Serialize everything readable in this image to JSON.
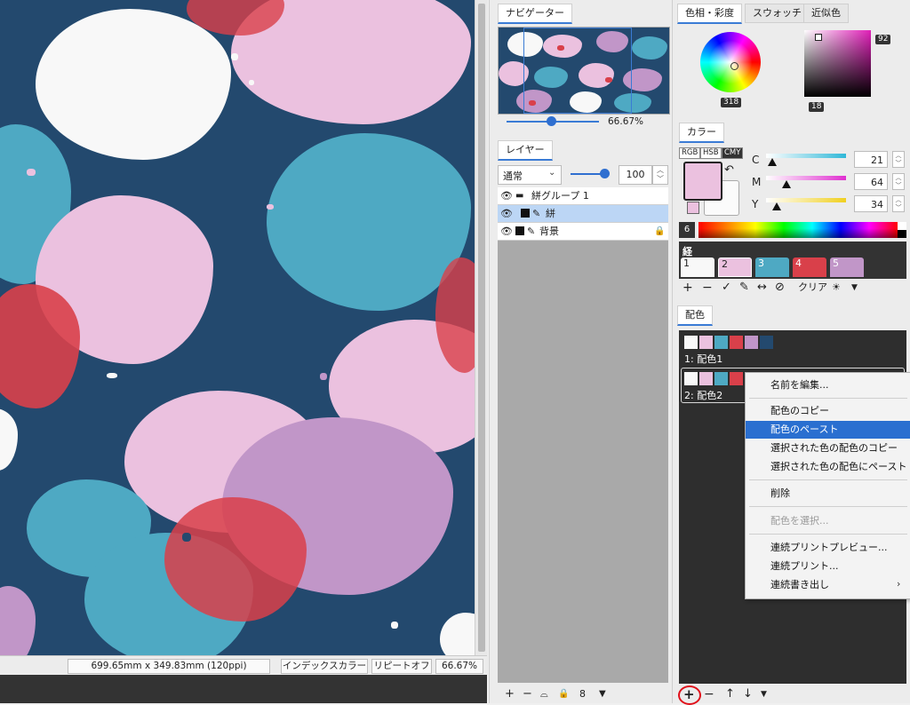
{
  "canvas": {
    "status": {
      "size": "699.65mm x 349.83mm (120ppi)",
      "mode": "インデックスカラー",
      "repeat": "リピートオフ",
      "zoom": "66.67%"
    }
  },
  "navigator": {
    "tab": "ナビゲーター",
    "zoom": "66.67%"
  },
  "layers": {
    "tab": "レイヤー",
    "blend_mode": "通常",
    "opacity": "100",
    "rows": [
      {
        "name": "絣グループ 1",
        "icon": "folder-icon"
      },
      {
        "name": "絣",
        "icon": "pencil-icon"
      },
      {
        "name": "背景",
        "icon": "lock-icon"
      }
    ],
    "toolbar": [
      "+",
      "−"
    ]
  },
  "color_picker": {
    "tabs": [
      "色相・彩度",
      "スウォッチ",
      "近似色"
    ],
    "hue_value": "318",
    "saturation_value": "92",
    "brightness_value": "18"
  },
  "color_panel": {
    "tab": "カラー",
    "modes": [
      "RGB",
      "HSB",
      "CMY"
    ],
    "sliders": [
      {
        "label": "C",
        "value": "21"
      },
      {
        "label": "M",
        "value": "64"
      },
      {
        "label": "Y",
        "value": "34"
      }
    ],
    "spectrum_num": "6"
  },
  "warp_panel": {
    "title": "経",
    "cells": [
      {
        "num": "1",
        "color": "#f8f8f8"
      },
      {
        "num": "2",
        "color": "#ebc1df"
      },
      {
        "num": "3",
        "color": "#4ea9c3"
      },
      {
        "num": "4",
        "color": "#d9404a"
      },
      {
        "num": "5",
        "color": "#c196c8"
      }
    ],
    "clear_label": "クリア"
  },
  "schemes": {
    "tab": "配色",
    "items": [
      {
        "label": "1: 配色1",
        "colors": [
          "#f8f8f8",
          "#ebc1df",
          "#4ea9c3",
          "#d9404a",
          "#c196c8",
          "#23496e"
        ]
      },
      {
        "label": "2: 配色2",
        "colors": [
          "#f8f8f8",
          "#ebc1df",
          "#4ea9c3",
          "#d9404a",
          "#c196c8"
        ]
      }
    ]
  },
  "context_menu": {
    "items": [
      {
        "label": "名前を編集..."
      },
      {
        "label": "配色のコピー"
      },
      {
        "label": "配色のペースト"
      },
      {
        "label": "選択された色の配色のコピー"
      },
      {
        "label": "選択された色の配色にペースト"
      },
      {
        "label": "削除"
      },
      {
        "label": "配色を選択..."
      },
      {
        "label": "連続プリントプレビュー..."
      },
      {
        "label": "連続プリント..."
      },
      {
        "label": "連続書き出し"
      }
    ]
  },
  "colors": {
    "navy": "#23496e",
    "pink": "#ebc1df",
    "teal": "#4ea9c3",
    "red": "#d9404a",
    "lavender": "#c196c8",
    "white": "#f8f8f8",
    "accent": "#2a6fd0"
  }
}
